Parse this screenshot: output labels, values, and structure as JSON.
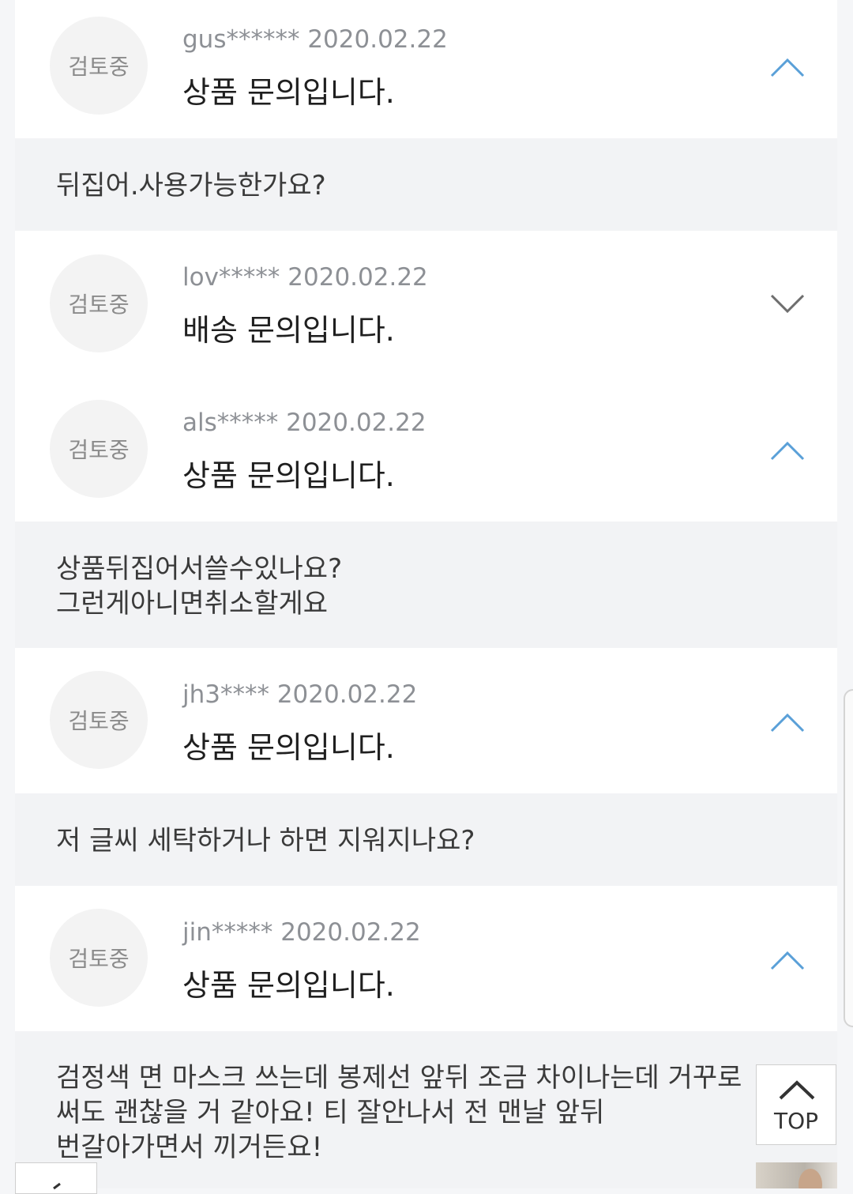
{
  "status_label": "검토중",
  "items": [
    {
      "meta": "gus****** 2020.02.22",
      "subject": "상품 문의입니다.",
      "expanded": true,
      "answer": "뒤집어.사용가능한가요?"
    },
    {
      "meta": "lov***** 2020.02.22",
      "subject": "배송 문의입니다.",
      "expanded": false
    },
    {
      "meta": "als***** 2020.02.22",
      "subject": "상품 문의입니다.",
      "expanded": true,
      "answer": "상품뒤집어서쓸수있나요?\n그런게아니면취소할게요"
    },
    {
      "meta": "jh3**** 2020.02.22",
      "subject": "상품 문의입니다.",
      "expanded": true,
      "answer": "저 글씨 세탁하거나 하면 지워지나요?"
    },
    {
      "meta": "jin***** 2020.02.22",
      "subject": "상품 문의입니다.",
      "expanded": true,
      "answer": "검정색 면 마스크 쓰는데 봉제선 앞뒤 조금 차이나는데 거꾸로\n써도 괜찮을 거 같아요! 티 잘안나서 전 맨날 앞뒤\n번갈아가면서 끼거든요!"
    }
  ],
  "top_button": {
    "label": "TOP"
  },
  "colors": {
    "chevron": "#5aa0d8",
    "chevron_collapsed": "#6e6e6e",
    "answer_bg": "#f2f3f5"
  }
}
